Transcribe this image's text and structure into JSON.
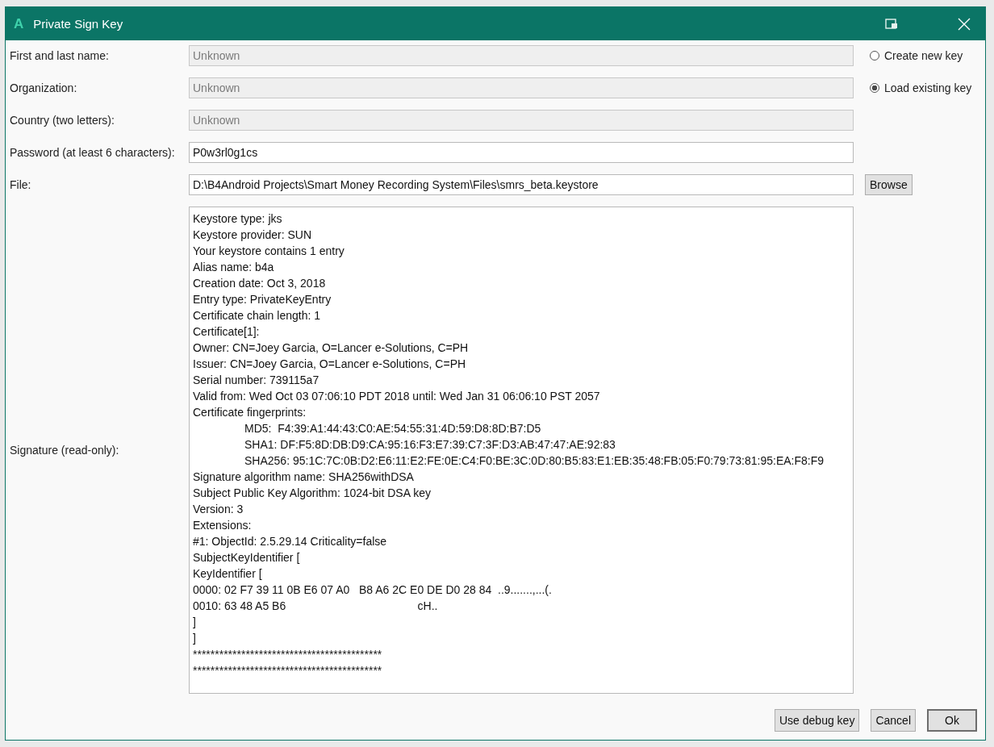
{
  "window": {
    "logo": "A",
    "title": "Private Sign Key"
  },
  "fields": [
    {
      "label": "First and last name:",
      "value": "Unknown",
      "disabled": true
    },
    {
      "label": "Organization:",
      "value": "Unknown",
      "disabled": true
    },
    {
      "label": "Country (two letters):",
      "value": "Unknown",
      "disabled": true
    },
    {
      "label": "Password (at least 6 characters):",
      "value": "P0w3rl0g1cs",
      "disabled": false
    },
    {
      "label": "File:",
      "value": "D:\\B4Android Projects\\Smart Money Recording System\\Files\\smrs_beta.keystore",
      "disabled": false
    }
  ],
  "key_options": [
    {
      "label": "Create new key",
      "selected": false
    },
    {
      "label": "Load existing key",
      "selected": true
    }
  ],
  "browse_button": "Browse",
  "signature": {
    "label": "Signature (read-only):",
    "lines": [
      {
        "text": "Keystore type: jks"
      },
      {
        "text": "Keystore provider: SUN"
      },
      {
        "text": "Your keystore contains 1 entry"
      },
      {
        "text": "Alias name: b4a"
      },
      {
        "text": "Creation date: Oct 3, 2018"
      },
      {
        "text": "Entry type: PrivateKeyEntry"
      },
      {
        "text": "Certificate chain length: 1"
      },
      {
        "text": "Certificate[1]:"
      },
      {
        "text": "Owner: CN=Joey Garcia, O=Lancer e-Solutions, C=PH"
      },
      {
        "text": "Issuer: CN=Joey Garcia, O=Lancer e-Solutions, C=PH"
      },
      {
        "text": "Serial number: 739115a7"
      },
      {
        "text": "Valid from: Wed Oct 03 07:06:10 PDT 2018 until: Wed Jan 31 06:06:10 PST 2057"
      },
      {
        "text": "Certificate fingerprints:",
        "children": [
          {
            "text": "MD5:  F4:39:A1:44:43:C0:AE:54:55:31:4D:59:D8:8D:B7:D5"
          },
          {
            "text": "SHA1: DF:F5:8D:DB:D9:CA:95:16:F3:E7:39:C7:3F:D3:AB:47:47:AE:92:83"
          },
          {
            "text": "SHA256: 95:1C:7C:0B:D2:E6:11:E2:FE:0E:C4:F0:BE:3C:0D:80:B5:83:E1:EB:35:48:FB:05:F0:79:73:81:95:EA:F8:F9"
          }
        ]
      },
      {
        "text": "Signature algorithm name: SHA256withDSA"
      },
      {
        "text": "Subject Public Key Algorithm: 1024-bit DSA key"
      },
      {
        "text": "Version: 3"
      },
      {
        "text": "Extensions:"
      },
      {
        "text": "#1: ObjectId: 2.5.29.14 Criticality=false"
      },
      {
        "text": "SubjectKeyIdentifier ["
      },
      {
        "text": "KeyIdentifier ["
      },
      {
        "text": "0000: 02 F7 39 11 0B E6 07 A0   B8 A6 2C E0 DE D0 28 84  ..9.......,...(."
      },
      {
        "text": "0010: 63 48 A5 B6                                          cH.."
      },
      {
        "text": "]"
      },
      {
        "text": "]"
      },
      {
        "text": "*******************************************"
      },
      {
        "text": "*******************************************"
      }
    ]
  },
  "buttons": [
    {
      "label": "Use debug key",
      "default": false
    },
    {
      "label": "Cancel",
      "default": false
    },
    {
      "label": "Ok",
      "default": true
    }
  ]
}
